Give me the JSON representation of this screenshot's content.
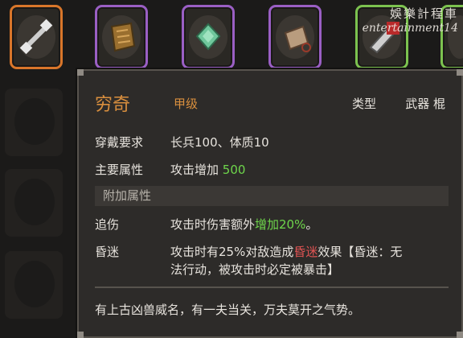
{
  "watermark": {
    "cn": "娛樂計程車",
    "en": "entertainment14"
  },
  "slots": [
    {
      "name": "mace-weapon-slot",
      "border": "#d9762a"
    },
    {
      "name": "armor-item-slot",
      "border": "#9a5fc4"
    },
    {
      "name": "jade-item-slot",
      "border": "#9a5fc4"
    },
    {
      "name": "pouch-item-slot",
      "border": "#9a5fc4"
    },
    {
      "name": "blade-item-slot",
      "border": "#7cc24f"
    }
  ],
  "tooltip": {
    "name": "穷奇",
    "grade": "甲级",
    "type_label": "类型",
    "type_value": "武器 棍",
    "req_label": "穿戴要求",
    "req_value": "长兵100、体质10",
    "main_label": "主要属性",
    "main_value_prefix": "攻击增加 ",
    "main_value_num": "500",
    "extra_section": "附加属性",
    "chase_label": "追伤",
    "chase_prefix": "攻击时伤害额外",
    "chase_highlight": "增加20%",
    "chase_suffix": "。",
    "stun_label": "昏迷",
    "stun_line1_prefix": "攻击时有25%对敌造成",
    "stun_line1_highlight": "昏迷",
    "stun_line1_suffix": "效果【昏迷：无",
    "stun_line2": "法行动，被攻击时必定被暴击】",
    "flavor": "有上古凶兽威名，有一夫当关，万夫莫开之气势。"
  }
}
